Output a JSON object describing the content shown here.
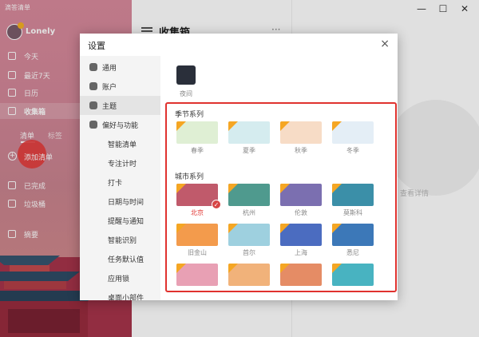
{
  "app": {
    "title": "滴答清单"
  },
  "window": {
    "minimize": "—",
    "maximize": "☐",
    "close": "✕"
  },
  "sidebar": {
    "username": "Lonely",
    "nav": [
      {
        "label": "今天",
        "icon": "calendar-today-icon"
      },
      {
        "label": "最近7天",
        "icon": "calendar-week-icon"
      },
      {
        "label": "日历",
        "icon": "calendar-icon"
      },
      {
        "label": "收集箱",
        "icon": "inbox-icon",
        "active": true
      }
    ],
    "tabs": [
      "清单",
      "标签"
    ],
    "add_list": "添加清单",
    "footer": [
      {
        "label": "已完成",
        "icon": "checkbox-icon"
      },
      {
        "label": "垃圾桶",
        "icon": "trash-icon"
      },
      {
        "label": "摘要",
        "icon": "summary-icon"
      }
    ]
  },
  "main": {
    "title": "收集箱",
    "more": "···"
  },
  "detail": {
    "placeholder": "查看详情"
  },
  "dialog": {
    "title": "设置",
    "close": "×",
    "nav": [
      {
        "label": "通用",
        "sub": false
      },
      {
        "label": "账户",
        "sub": false
      },
      {
        "label": "主题",
        "sub": false,
        "active": true
      },
      {
        "label": "偏好与功能",
        "sub": false
      },
      {
        "label": "智能清单",
        "sub": true
      },
      {
        "label": "专注计时",
        "sub": true
      },
      {
        "label": "打卡",
        "sub": true
      },
      {
        "label": "日期与时间",
        "sub": true
      },
      {
        "label": "提醒与通知",
        "sub": true
      },
      {
        "label": "智能识别",
        "sub": true
      },
      {
        "label": "任务默认值",
        "sub": true
      },
      {
        "label": "应用锁",
        "sub": true
      },
      {
        "label": "桌面小部件",
        "sub": true
      }
    ],
    "night_label": "夜间",
    "seasons": {
      "title": "季节系列",
      "items": [
        {
          "label": "春季",
          "color": "#dfefd4"
        },
        {
          "label": "夏季",
          "color": "#d5ecef"
        },
        {
          "label": "秋季",
          "color": "#f7dcc6"
        },
        {
          "label": "冬季",
          "color": "#e4eef6"
        }
      ]
    },
    "cities": {
      "title": "城市系列",
      "items": [
        {
          "label": "北京",
          "color": "#c05a6b",
          "selected": true
        },
        {
          "label": "杭州",
          "color": "#4f9a8e"
        },
        {
          "label": "伦敦",
          "color": "#7b6fb0"
        },
        {
          "label": "莫斯科",
          "color": "#3b8fa8"
        },
        {
          "label": "旧金山",
          "color": "#f39b4c"
        },
        {
          "label": "首尔",
          "color": "#9ed0df"
        },
        {
          "label": "上海",
          "color": "#4b6cc0"
        },
        {
          "label": "悉尼",
          "color": "#3c78b8"
        },
        {
          "label": "",
          "color": "#e8a0b4"
        },
        {
          "label": "",
          "color": "#f1b27a"
        },
        {
          "label": "",
          "color": "#e58c65"
        },
        {
          "label": "",
          "color": "#48b3c1"
        }
      ]
    },
    "check_mark": "✓"
  }
}
